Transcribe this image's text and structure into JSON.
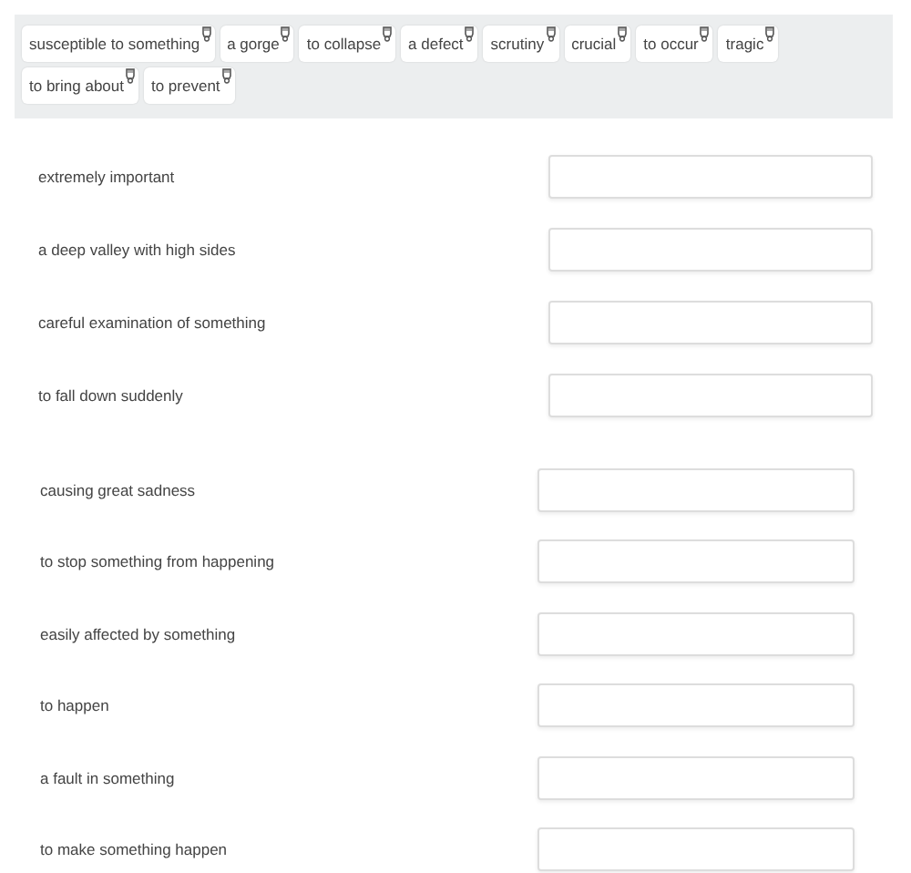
{
  "word_bank": [
    {
      "label": "susceptible to something"
    },
    {
      "label": "a gorge"
    },
    {
      "label": "to collapse"
    },
    {
      "label": "a defect"
    },
    {
      "label": "scrutiny"
    },
    {
      "label": "crucial"
    },
    {
      "label": "to occur"
    },
    {
      "label": "tragic"
    },
    {
      "label": "to bring about"
    },
    {
      "label": "to prevent"
    }
  ],
  "groups": [
    {
      "items": [
        {
          "prompt": "extremely important"
        },
        {
          "prompt": "a deep valley with high sides"
        },
        {
          "prompt": "careful examination of something"
        },
        {
          "prompt": "to fall down suddenly"
        }
      ]
    },
    {
      "items": [
        {
          "prompt": "causing great sadness"
        },
        {
          "prompt": "to stop something from happening"
        },
        {
          "prompt": "easily affected by something"
        },
        {
          "prompt": "to happen"
        },
        {
          "prompt": "a fault in something"
        },
        {
          "prompt": "to make something happen"
        }
      ]
    }
  ]
}
